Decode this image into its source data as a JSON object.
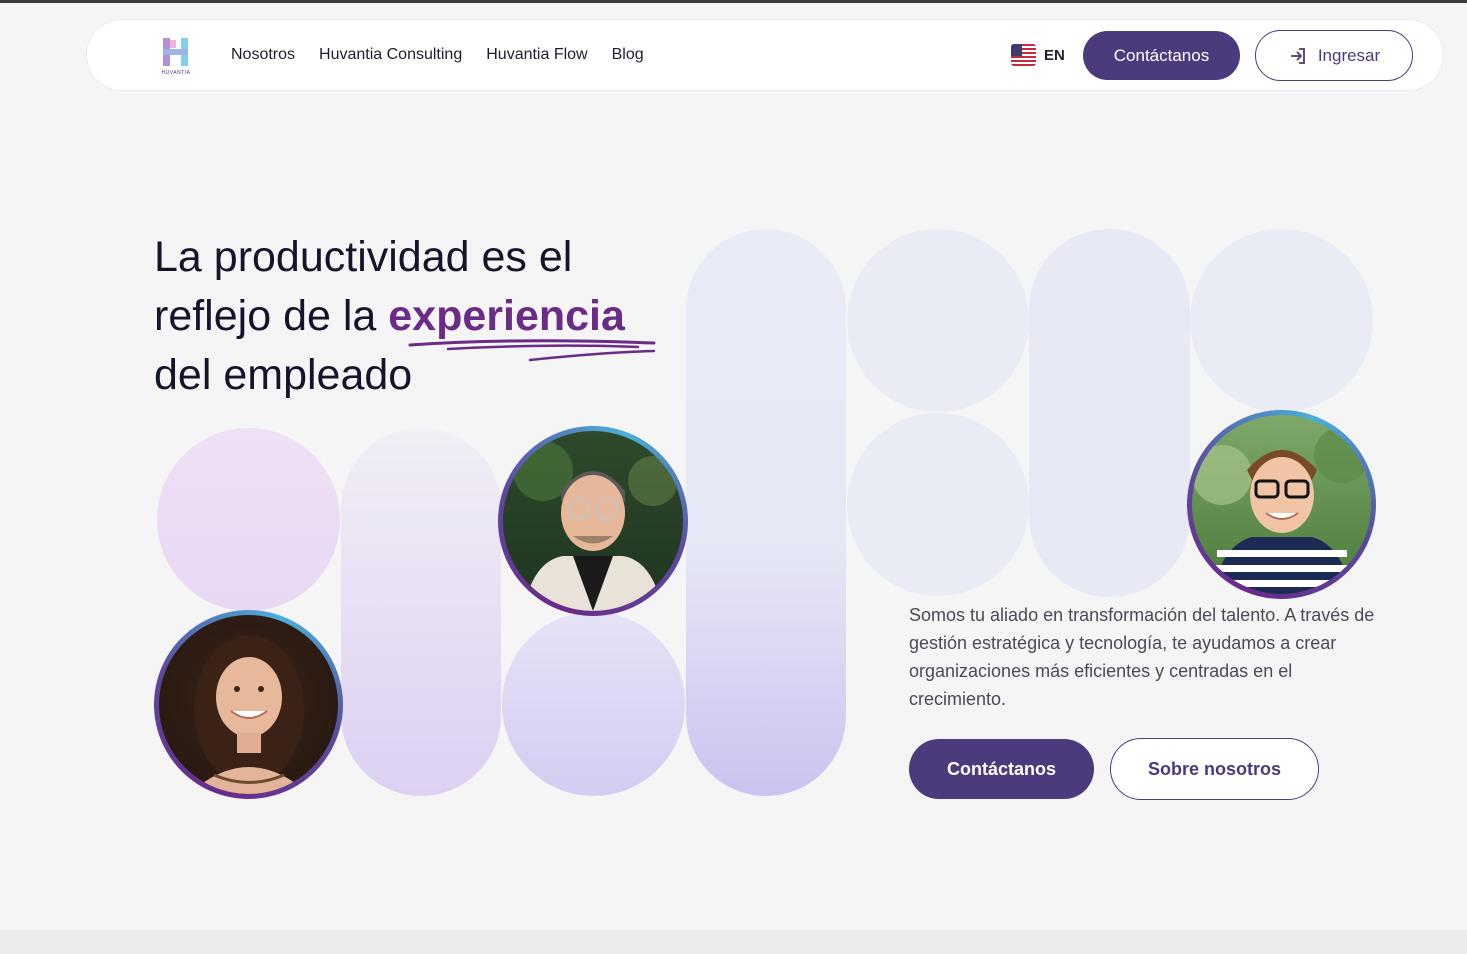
{
  "brand": {
    "logo_text": "HUVANTIA"
  },
  "nav": {
    "links": [
      "Nosotros",
      "Huvantia Consulting",
      "Huvantia Flow",
      "Blog"
    ],
    "language": "EN",
    "contact_label": "Contáctanos",
    "login_label": "Ingresar"
  },
  "hero": {
    "title_part1": "La productividad es el reflejo de la ",
    "title_highlight": "experiencia",
    "title_part2": "del empleado",
    "description": "Somos tu aliado en transformación del talento. A través de gestión estratégica y tecnología, te ayudamos a crear organizaciones más eficientes y centradas en el crecimiento.",
    "primary_button": "Contáctanos",
    "secondary_button": "Sobre nosotros"
  },
  "colors": {
    "primary": "#4b3a7c",
    "highlight": "#6a2c86",
    "background": "#f5f5f5"
  },
  "icons": [
    "login-icon",
    "us-flag-icon"
  ]
}
